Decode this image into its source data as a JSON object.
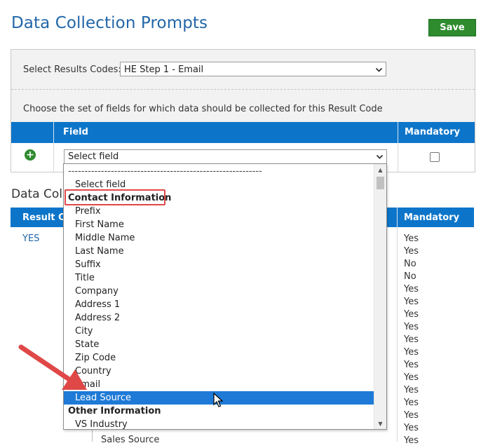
{
  "header": {
    "title": "Data Collection Prompts",
    "save_label": "Save"
  },
  "results_panel": {
    "label": "Select Results Codes:",
    "selected": "HE Step 1 - Email",
    "description": "Choose the set of fields for which data should be collected for this Result Code"
  },
  "field_table": {
    "headers": {
      "field": "Field",
      "mandatory": "Mandatory"
    },
    "field_select_value": "Select field"
  },
  "dropdown": {
    "dashes": "-----------------------------------------------------------",
    "items": [
      {
        "label": "Select field",
        "type": "option"
      },
      {
        "label": "Contact Information",
        "type": "group"
      },
      {
        "label": "Prefix",
        "type": "option"
      },
      {
        "label": "First Name",
        "type": "option"
      },
      {
        "label": "Middle Name",
        "type": "option"
      },
      {
        "label": "Last Name",
        "type": "option"
      },
      {
        "label": "Suffix",
        "type": "option"
      },
      {
        "label": "Title",
        "type": "option"
      },
      {
        "label": "Company",
        "type": "option"
      },
      {
        "label": "Address 1",
        "type": "option"
      },
      {
        "label": "Address 2",
        "type": "option"
      },
      {
        "label": "City",
        "type": "option"
      },
      {
        "label": "State",
        "type": "option"
      },
      {
        "label": "Zip Code",
        "type": "option"
      },
      {
        "label": "Country",
        "type": "option"
      },
      {
        "label": "Email",
        "type": "option"
      },
      {
        "label": "Lead Source",
        "type": "option",
        "selected": true
      },
      {
        "label": "Other Information",
        "type": "group"
      },
      {
        "label": "VS Industry",
        "type": "option"
      }
    ]
  },
  "section2": {
    "title": "Data Colle",
    "headers": {
      "result_code": "Result Co",
      "mandatory": "Mandatory"
    },
    "result_code_link": "YES",
    "mandatory_values": [
      "Yes",
      "Yes",
      "No",
      "No",
      "Yes",
      "Yes",
      "Yes",
      "Yes",
      "Yes",
      "Yes",
      "Yes",
      "Yes",
      "Yes",
      "Yes",
      "Yes",
      "Yes",
      "Yes"
    ],
    "trailing_item": "Sales Source"
  },
  "colors": {
    "accent": "#0d75c9",
    "title": "#2166a8",
    "save": "#2e8b2e",
    "annotation": "#e04848",
    "selected_row": "#1e7ad6"
  },
  "icons": {
    "add": "plus-circle-icon",
    "dropdown": "chevron-down-icon",
    "cursor": "mouse-pointer-icon",
    "annotation": "arrow-annotation-icon"
  }
}
